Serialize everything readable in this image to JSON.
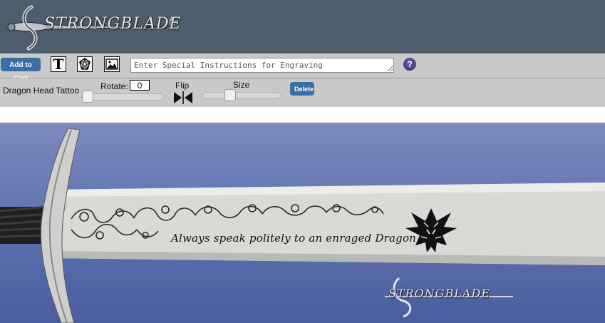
{
  "header": {
    "brand": "STRONGBLADE",
    "registered": "®"
  },
  "toolbar": {
    "add_to_cart": "Add to Cart",
    "text_tool": "T",
    "engraving_placeholder": "Enter Special Instructions for Engraving",
    "help": "?"
  },
  "layer": {
    "name": "Dragon Head Tattoo",
    "rotate_label": "Rotate:",
    "rotate_value": "0",
    "rotate_slider_fraction": 0.0,
    "flip_label": "Flip",
    "size_label": "Size",
    "size_slider_fraction": 0.35,
    "delete": "Delete"
  },
  "preview": {
    "engraving_text": "Always speak politely to an enraged Dragon.",
    "watermark": "STRONGBLADE",
    "colors": {
      "background": "#5b6fad",
      "blade": "#d9d9d6"
    }
  },
  "colors": {
    "header_bg": "#4e5c6b",
    "toolbar_bg": "#c9c9c9",
    "button_blue": "#3b6ea5",
    "help_purple": "#5b4d9a"
  }
}
